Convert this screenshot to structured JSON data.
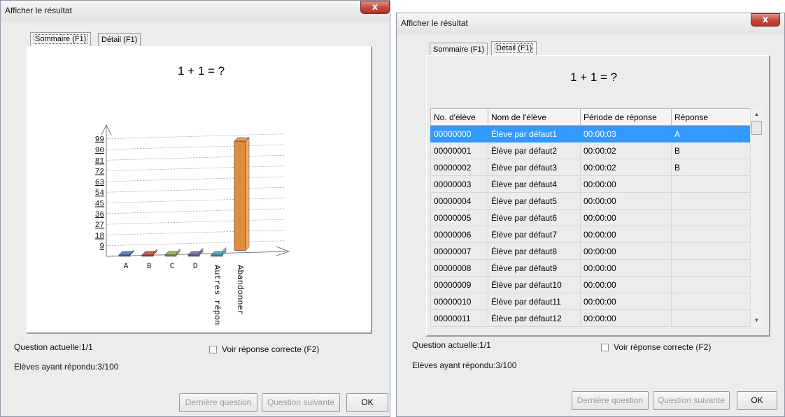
{
  "left_window": {
    "title": "Afficher le résultat",
    "close_label": "x",
    "tabs": [
      "Sommaire (F1)",
      "Détail (F1)"
    ],
    "question_heading": "1 + 1 = ?",
    "status": {
      "current_question": "Question actuelle:1/1",
      "answered": "Elèves ayant répondu:3/100"
    },
    "show_answer_label": "Voir réponse correcte (F2)",
    "buttons": {
      "prev": "Dernière question",
      "next": "Question suivante",
      "ok": "OK"
    }
  },
  "right_window": {
    "title": "Afficher le résultat",
    "close_label": "x",
    "tabs": [
      "Sommaire (F1)",
      "Détail (F1)"
    ],
    "question_heading": "1 + 1 = ?",
    "table": {
      "columns": [
        "No. d'élève",
        "Nom de l'élève",
        "Période de réponse",
        "Réponse"
      ],
      "rows": [
        [
          "00000000",
          "Élève par défaut1",
          "00:00:03",
          "A"
        ],
        [
          "00000001",
          "Élève par défaut2",
          "00:00:02",
          "B"
        ],
        [
          "00000002",
          "Élève par défaut3",
          "00:00:02",
          "B"
        ],
        [
          "00000003",
          "Élève par défaut4",
          "00:00:00",
          ""
        ],
        [
          "00000004",
          "Élève par défaut5",
          "00:00:00",
          ""
        ],
        [
          "00000005",
          "Élève par défaut6",
          "00:00:00",
          ""
        ],
        [
          "00000006",
          "Élève par défaut7",
          "00:00:00",
          ""
        ],
        [
          "00000007",
          "Élève par défaut8",
          "00:00:00",
          ""
        ],
        [
          "00000008",
          "Élève par défaut9",
          "00:00:00",
          ""
        ],
        [
          "00000009",
          "Élève par défaut10",
          "00:00:00",
          ""
        ],
        [
          "00000010",
          "Élève par défaut11",
          "00:00:00",
          ""
        ],
        [
          "00000011",
          "Élève par défaut12",
          "00:00:00",
          ""
        ]
      ],
      "selected_row": 0
    },
    "status": {
      "current_question": "Question actuelle:1/1",
      "answered": "Elèves ayant répondu:3/100"
    },
    "show_answer_label": "Voir réponse correcte (F2)",
    "buttons": {
      "prev": "Dernière question",
      "next": "Question suivante",
      "ok": "OK"
    }
  },
  "chart_data": {
    "type": "bar",
    "categories": [
      "A",
      "B",
      "C",
      "D",
      "Autres réponses",
      "Abandonner"
    ],
    "values": [
      1,
      1,
      0,
      0,
      0,
      97
    ],
    "colors": [
      "#3b6fc1",
      "#c0413b",
      "#8db04a",
      "#7a5ca8",
      "#3ea3c4",
      "#e58a3c"
    ],
    "y_ticks": [
      "9",
      "18",
      "27",
      "36",
      "45",
      "54",
      "63",
      "72",
      "81",
      "90",
      "99"
    ],
    "ylim": [
      0,
      100
    ],
    "title": "",
    "grid": true
  }
}
